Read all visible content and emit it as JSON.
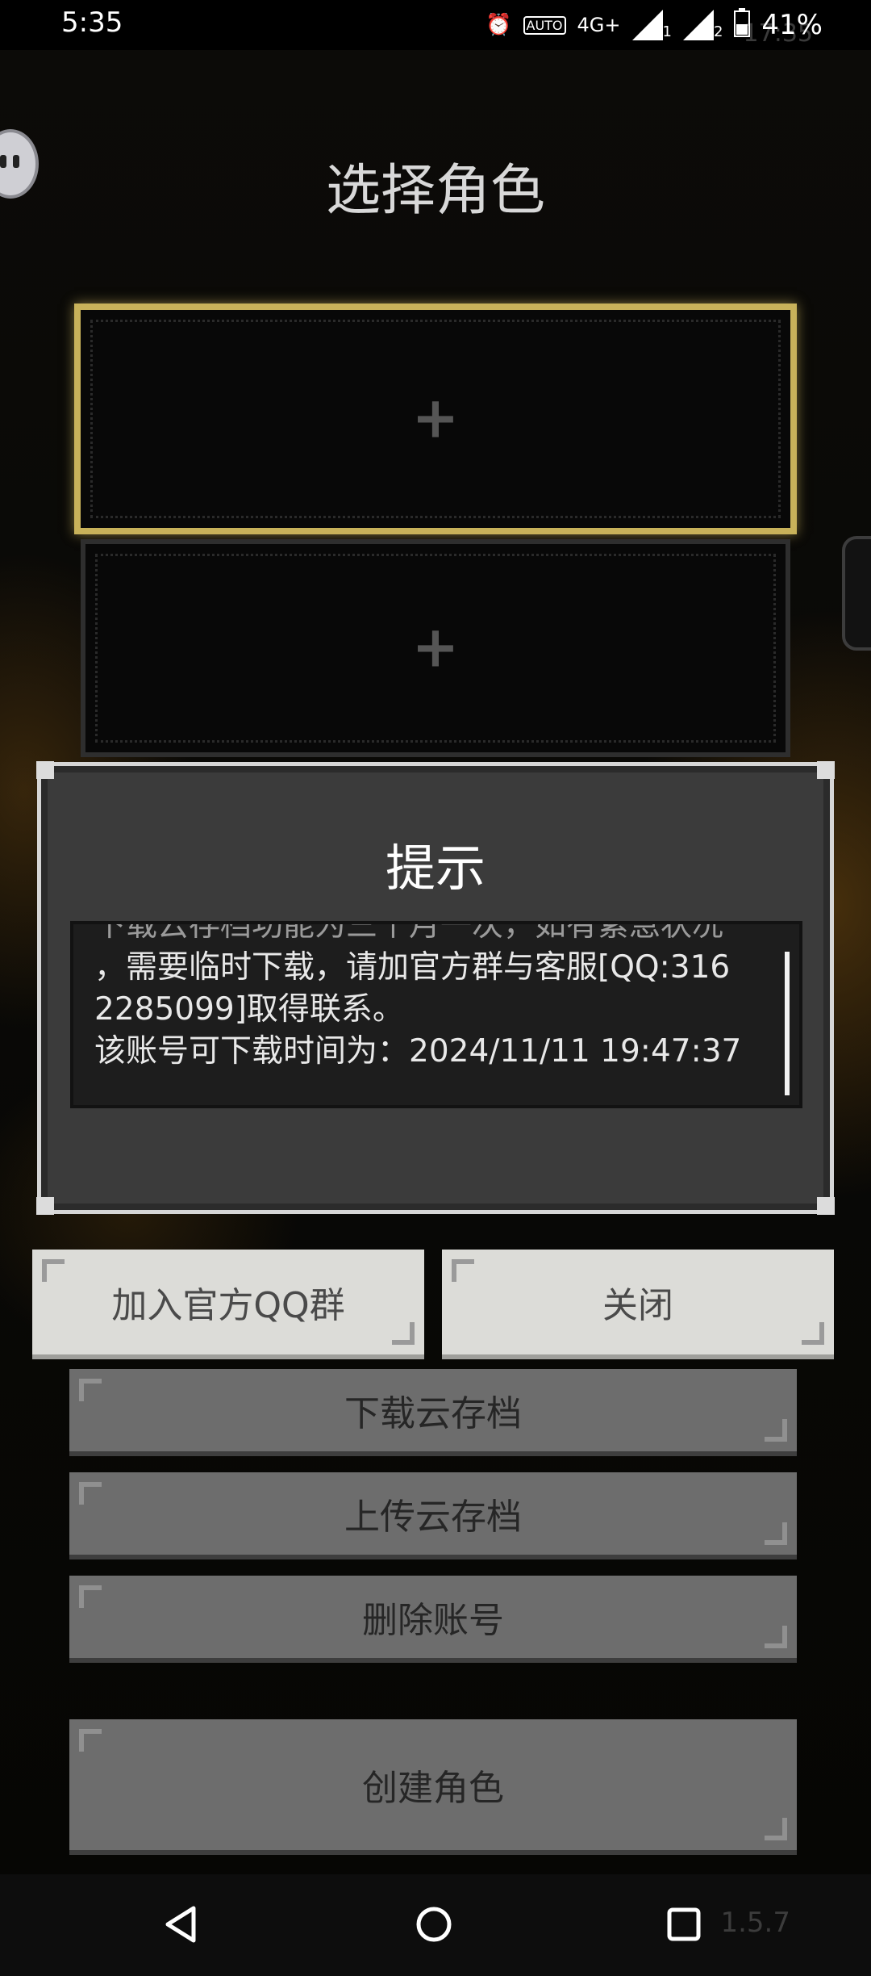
{
  "status_bar": {
    "time": "5:35",
    "network": "4G+",
    "sim1": "1",
    "sim2": "2",
    "battery": "41%",
    "ghost_time": "17:35"
  },
  "screen": {
    "title": "选择角色"
  },
  "slots": [
    {
      "symbol": "+",
      "selected": true
    },
    {
      "symbol": "+",
      "selected": false
    }
  ],
  "dialog": {
    "title": "提示",
    "lines": [
      "下载云存档功能为三个月一次，如有紧急状况",
      "，需要临时下载，请加官方群与客服[QQ:316",
      "2285099]取得联系。",
      "该账号可下载时间为：2024/11/11 19:47:37"
    ],
    "join_qq_label": "加入官方QQ群",
    "close_label": "关闭"
  },
  "menu": {
    "download_label": "下载云存档",
    "upload_label": "上传云存档",
    "delete_label": "删除账号",
    "create_label": "创建角色"
  },
  "version": "1.5.7",
  "colors": {
    "selected_border": "#c8b25a",
    "dialog_bg": "#3b3b3b",
    "button_light": "#dcdcd8",
    "button_grey": "#6d6d6d"
  }
}
